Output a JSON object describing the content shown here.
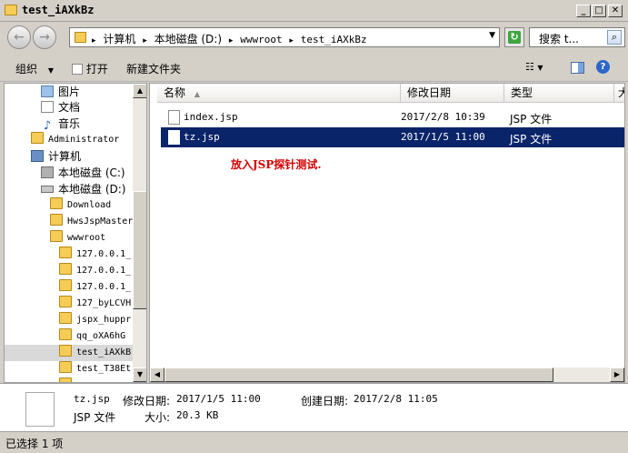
{
  "window": {
    "title": "test_iAXkBz"
  },
  "address": {
    "crumbs": [
      "计算机",
      "本地磁盘 (D:)",
      "wwwroot",
      "test_iAXkBz"
    ],
    "search_placeholder": "搜索 t..."
  },
  "toolbar": {
    "organize": "组织",
    "open": "打开",
    "new_folder": "新建文件夹"
  },
  "navpane": {
    "items": [
      {
        "label": "图片",
        "icon": "pictures-icon"
      },
      {
        "label": "文档",
        "icon": "documents-icon"
      },
      {
        "label": "音乐",
        "icon": "music-icon"
      },
      {
        "label": "Administrator",
        "icon": "user-folder-icon"
      },
      {
        "label": "计算机",
        "icon": "computer-icon"
      },
      {
        "label": "本地磁盘 (C:)",
        "icon": "drive-icon"
      },
      {
        "label": "本地磁盘 (D:)",
        "icon": "drive-icon"
      },
      {
        "label": "Download",
        "icon": "folder-icon"
      },
      {
        "label": "HwsJspMaster",
        "icon": "folder-icon"
      },
      {
        "label": "wwwroot",
        "icon": "folder-icon"
      },
      {
        "label": "127.0.0.1_",
        "icon": "folder-icon"
      },
      {
        "label": "127.0.0.1_",
        "icon": "folder-icon"
      },
      {
        "label": "127.0.0.1_",
        "icon": "folder-icon"
      },
      {
        "label": "127_byLCVH",
        "icon": "folder-icon"
      },
      {
        "label": "jspx_huppr",
        "icon": "folder-icon"
      },
      {
        "label": "qq_oXA6hG",
        "icon": "folder-icon"
      },
      {
        "label": "test_iAXkB",
        "icon": "folder-icon"
      },
      {
        "label": "test_T38Et",
        "icon": "folder-icon"
      },
      {
        "label": "",
        "icon": "folder-icon"
      }
    ]
  },
  "columns": {
    "name": "名称",
    "modified": "修改日期",
    "type": "类型",
    "size": "大"
  },
  "files": [
    {
      "name": "index.jsp",
      "modified": "2017/2/8 10:39",
      "type": "JSP 文件"
    },
    {
      "name": "tz.jsp",
      "modified": "2017/1/5 11:00",
      "type": "JSP 文件"
    }
  ],
  "annotation": "放入JSP探针测试.",
  "details": {
    "filename": "tz.jsp",
    "modified_label": "修改日期:",
    "modified_value": "2017/1/5 11:00",
    "created_label": "创建日期:",
    "created_value": "2017/2/8 11:05",
    "type": "JSP 文件",
    "size_label": "大小:",
    "size_value": "20.3 KB"
  },
  "status": {
    "text": "已选择 1 项"
  },
  "colors": {
    "selection": "#0a246a",
    "annotation": "#d40000",
    "chrome": "#d4d0c8"
  }
}
